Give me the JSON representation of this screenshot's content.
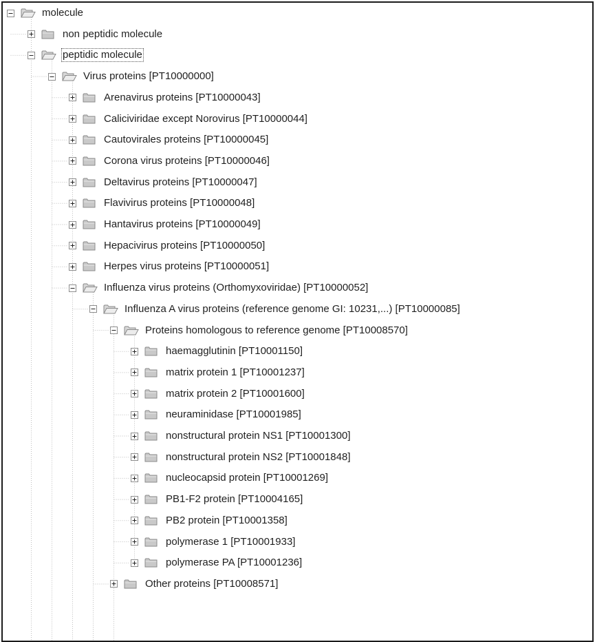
{
  "tree": [
    {
      "label": "molecule",
      "depth": 0,
      "expanded": true
    },
    {
      "label": "non peptidic molecule",
      "depth": 1,
      "expanded": false
    },
    {
      "label": "peptidic molecule",
      "depth": 1,
      "expanded": true,
      "selected": true
    },
    {
      "label": "Virus proteins [PT10000000]",
      "depth": 2,
      "expanded": true
    },
    {
      "label": "Arenavirus proteins [PT10000043]",
      "depth": 3,
      "expanded": false
    },
    {
      "label": "Caliciviridae except Norovirus [PT10000044]",
      "depth": 3,
      "expanded": false
    },
    {
      "label": "Cautovirales proteins [PT10000045]",
      "depth": 3,
      "expanded": false
    },
    {
      "label": "Corona virus proteins [PT10000046]",
      "depth": 3,
      "expanded": false
    },
    {
      "label": "Deltavirus proteins [PT10000047]",
      "depth": 3,
      "expanded": false
    },
    {
      "label": "Flavivirus proteins [PT10000048]",
      "depth": 3,
      "expanded": false
    },
    {
      "label": "Hantavirus proteins [PT10000049]",
      "depth": 3,
      "expanded": false
    },
    {
      "label": "Hepacivirus proteins [PT10000050]",
      "depth": 3,
      "expanded": false
    },
    {
      "label": "Herpes virus proteins [PT10000051]",
      "depth": 3,
      "expanded": false
    },
    {
      "label": "Influenza virus proteins (Orthomyxoviridae) [PT10000052]",
      "depth": 3,
      "expanded": true
    },
    {
      "label": "Influenza A virus proteins (reference genome GI: 10231,...) [PT10000085]",
      "depth": 4,
      "expanded": true
    },
    {
      "label": "Proteins homologous to reference genome [PT10008570]",
      "depth": 5,
      "expanded": true
    },
    {
      "label": "haemagglutinin [PT10001150]",
      "depth": 6,
      "expanded": false
    },
    {
      "label": "matrix protein 1 [PT10001237]",
      "depth": 6,
      "expanded": false
    },
    {
      "label": "matrix protein 2 [PT10001600]",
      "depth": 6,
      "expanded": false
    },
    {
      "label": "neuraminidase [PT10001985]",
      "depth": 6,
      "expanded": false
    },
    {
      "label": "nonstructural protein NS1 [PT10001300]",
      "depth": 6,
      "expanded": false
    },
    {
      "label": "nonstructural protein NS2 [PT10001848]",
      "depth": 6,
      "expanded": false
    },
    {
      "label": "nucleocapsid protein [PT10001269]",
      "depth": 6,
      "expanded": false
    },
    {
      "label": "PB1-F2 protein [PT10004165]",
      "depth": 6,
      "expanded": false
    },
    {
      "label": "PB2 protein [PT10001358]",
      "depth": 6,
      "expanded": false
    },
    {
      "label": "polymerase 1 [PT10001933]",
      "depth": 6,
      "expanded": false
    },
    {
      "label": "polymerase PA [PT10001236]",
      "depth": 6,
      "expanded": false
    },
    {
      "label": "Other proteins [PT10008571]",
      "depth": 5,
      "expanded": false
    }
  ],
  "colors": {
    "text": "#1f1f1f",
    "folder": "#c9c9c9",
    "folder_border": "#8a8a8a",
    "toggle_border": "#8c8c8c",
    "guide": "#bdbdbd"
  }
}
